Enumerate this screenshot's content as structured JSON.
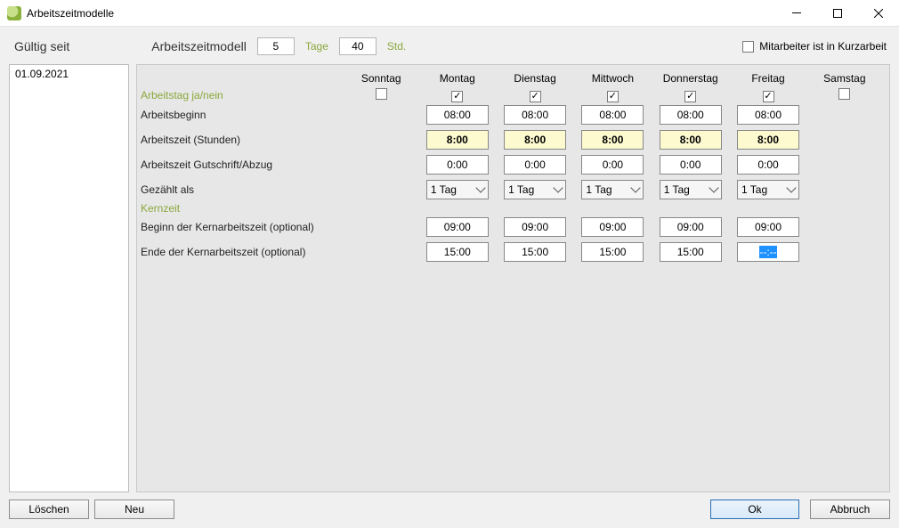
{
  "window": {
    "title": "Arbeitszeitmodelle"
  },
  "top": {
    "gueltig_seit_label": "Gültig seit",
    "model_label": "Arbeitszeitmodell",
    "model_count": "5",
    "tage_label": "Tage",
    "stunden_value": "40",
    "std_label": "Std.",
    "kurzarbeit_label": "Mitarbeiter ist in Kurzarbeit",
    "kurzarbeit_checked": false
  },
  "sidebar": {
    "items": [
      "01.09.2021"
    ]
  },
  "days": [
    "Sonntag",
    "Montag",
    "Dienstag",
    "Mittwoch",
    "Donnerstag",
    "Freitag",
    "Samstag"
  ],
  "sections": {
    "arbeitstag_label": "Arbeitstag ja/nein",
    "arbeitsbeginn_label": "Arbeitsbeginn",
    "arbeitszeit_label": "Arbeitszeit (Stunden)",
    "gutschrift_label": "Arbeitszeit Gutschrift/Abzug",
    "gezaehlt_label": "Gezählt als",
    "kernzeit_label": "Kernzeit",
    "kern_beginn_label": "Beginn der Kernarbeitszeit (optional)",
    "kern_ende_label": "Ende der Kernarbeitszeit (optional)"
  },
  "data": {
    "arbeitstag": [
      false,
      true,
      true,
      true,
      true,
      true,
      false
    ],
    "arbeitsbeginn": [
      null,
      "08:00",
      "08:00",
      "08:00",
      "08:00",
      "08:00",
      null
    ],
    "arbeitszeit": [
      null,
      "8:00",
      "8:00",
      "8:00",
      "8:00",
      "8:00",
      null
    ],
    "gutschrift": [
      null,
      "0:00",
      "0:00",
      "0:00",
      "0:00",
      "0:00",
      null
    ],
    "gezaehlt": [
      null,
      "1 Tag",
      "1 Tag",
      "1 Tag",
      "1 Tag",
      "1 Tag",
      null
    ],
    "kern_beginn": [
      null,
      "09:00",
      "09:00",
      "09:00",
      "09:00",
      "09:00",
      null
    ],
    "kern_ende": [
      null,
      "15:00",
      "15:00",
      "15:00",
      "15:00",
      "--:--",
      null
    ],
    "kern_ende_selected_idx": 5
  },
  "buttons": {
    "delete": "Löschen",
    "new": "Neu",
    "ok": "Ok",
    "cancel": "Abbruch"
  }
}
